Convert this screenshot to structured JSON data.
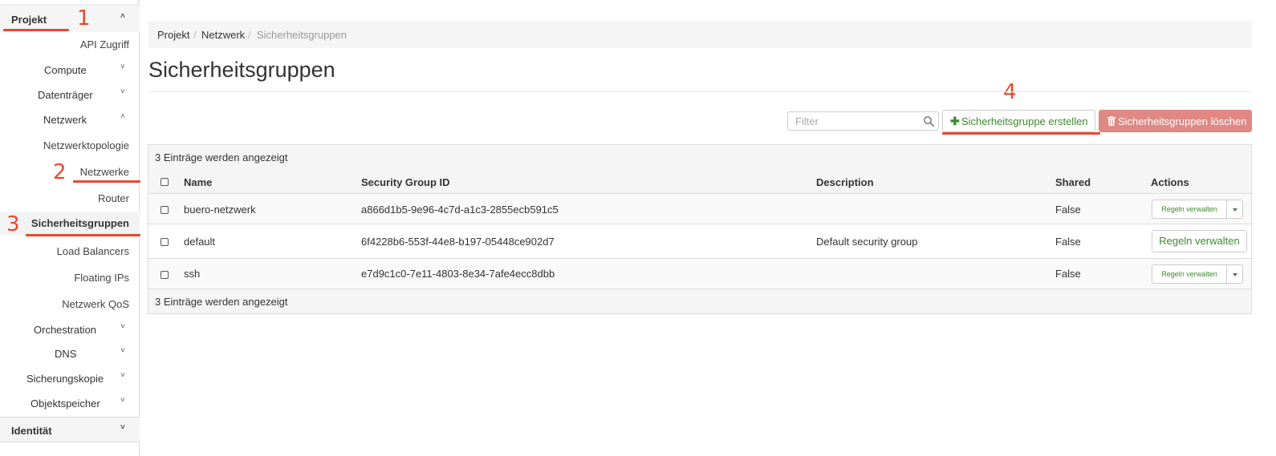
{
  "sidebar": {
    "project": {
      "label": "Projekt",
      "chevron": "˄"
    },
    "items": [
      {
        "label": "API Zugriff",
        "chevron": ""
      },
      {
        "label": "Compute",
        "chevron": "˅"
      },
      {
        "label": "Datenträger",
        "chevron": "˅"
      },
      {
        "label": "Netzwerk",
        "chevron": "˄"
      },
      {
        "label": "Netzwerktopologie",
        "chevron": ""
      },
      {
        "label": "Netzwerke",
        "chevron": ""
      },
      {
        "label": "Router",
        "chevron": ""
      },
      {
        "label": "Sicherheitsgruppen",
        "chevron": ""
      },
      {
        "label": "Load Balancers",
        "chevron": ""
      },
      {
        "label": "Floating IPs",
        "chevron": ""
      },
      {
        "label": "Netzwerk QoS",
        "chevron": ""
      },
      {
        "label": "Orchestration",
        "chevron": "˅"
      },
      {
        "label": "DNS",
        "chevron": "˅"
      },
      {
        "label": "Sicherungskopie",
        "chevron": "˅"
      },
      {
        "label": "Objektspeicher",
        "chevron": "˅"
      }
    ],
    "identity": {
      "label": "Identität",
      "chevron": "˅"
    }
  },
  "annotations": [
    "1",
    "2",
    "3",
    "4"
  ],
  "breadcrumb": {
    "items": [
      "Projekt",
      "Netzwerk",
      "Sicherheitsgruppen"
    ],
    "separator": "/"
  },
  "page_title": "Sicherheitsgruppen",
  "toolbar": {
    "filter_placeholder": "Filter",
    "create_plus": "✚",
    "create_label": "Sicherheitsgruppe erstellen",
    "delete_label": "Sicherheitsgruppen löschen"
  },
  "table": {
    "caption_top": "3 Einträge werden angezeigt",
    "caption_bottom": "3 Einträge werden angezeigt",
    "columns": [
      "Name",
      "Security Group ID",
      "Description",
      "Shared",
      "Actions"
    ],
    "rows": [
      {
        "name": "buero-netzwerk",
        "id": "a866d1b5-9e96-4c7d-a1c3-2855ecb591c5",
        "description": "",
        "shared": "False",
        "action": "Regeln verwalten"
      },
      {
        "name": "default",
        "id": "6f4228b6-553f-44e8-b197-05448ce902d7",
        "description": "Default security group",
        "shared": "False",
        "action": "Regeln verwalten"
      },
      {
        "name": "ssh",
        "id": "e7d9c1c0-7e11-4803-8e34-7afe4ecc8dbb",
        "description": "",
        "shared": "False",
        "action": "Regeln verwalten"
      }
    ]
  },
  "colors": {
    "annotation": "#e64a2e",
    "action_green": "#3c8a2e",
    "danger": "#e08884"
  }
}
